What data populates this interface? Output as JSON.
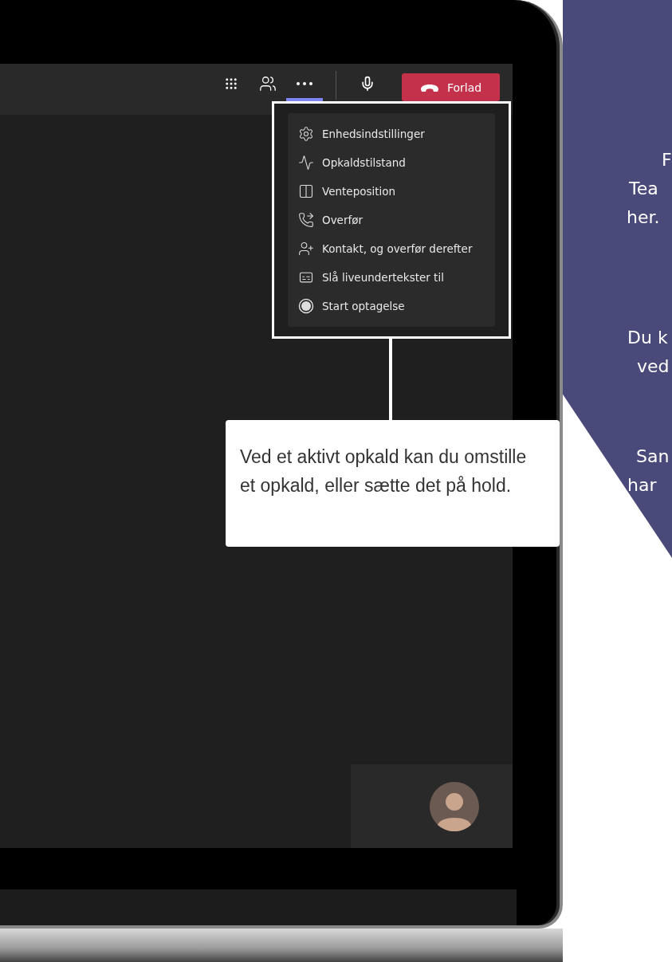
{
  "toolbar": {
    "more_active": true,
    "leave_button": "Forlad"
  },
  "more_menu": {
    "items": [
      {
        "kind": "settings",
        "label": "Enhedsindstillinger"
      },
      {
        "kind": "health",
        "label": "Opkaldstilstand"
      },
      {
        "kind": "hold",
        "label": "Venteposition"
      },
      {
        "kind": "transfer",
        "label": "Overfør"
      },
      {
        "kind": "consult",
        "label": "Kontakt, og overfør derefter"
      },
      {
        "kind": "captions",
        "label": "Slå liveundertekster til"
      },
      {
        "kind": "record",
        "label": "Start optagelse"
      }
    ]
  },
  "callout": {
    "text": "Ved et aktivt opkald kan du omstille et opkald, eller sætte det på hold."
  },
  "side_panel": {
    "lines": [
      "F",
      "Tea",
      "her.",
      "Du k",
      "ved",
      "San",
      "har"
    ]
  }
}
